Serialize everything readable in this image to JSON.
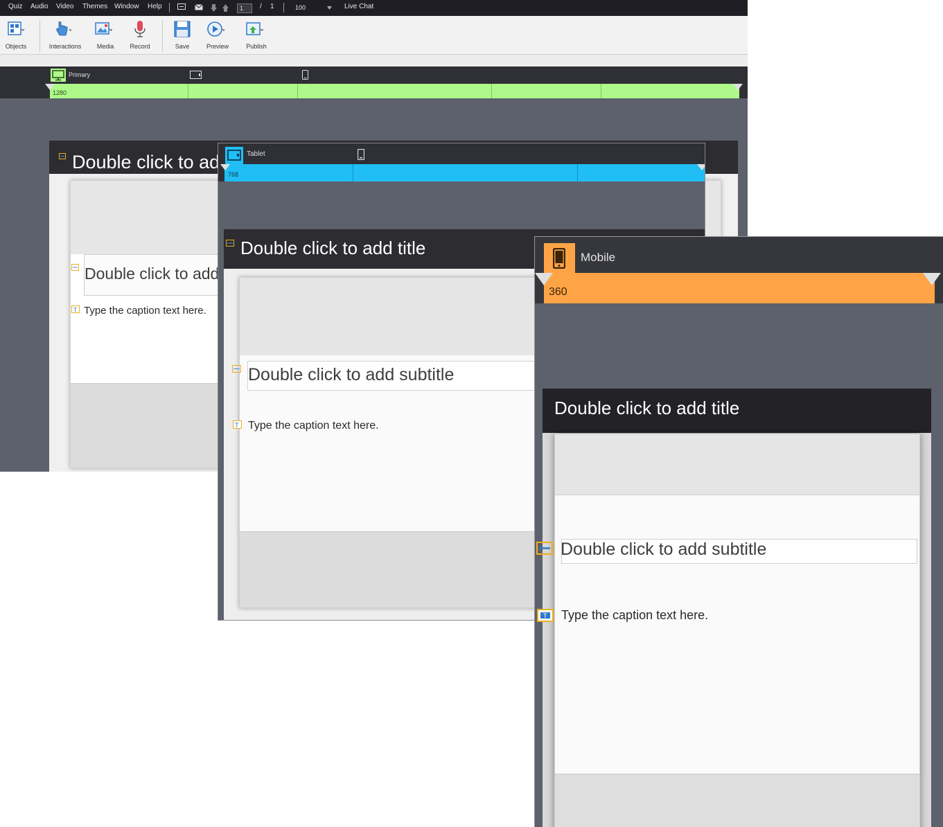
{
  "menubar": {
    "items": [
      "Quiz",
      "Audio",
      "Video",
      "Themes",
      "Window",
      "Help"
    ],
    "page_current": "1",
    "page_separator": "/",
    "page_total": "1",
    "zoom": "100",
    "live_chat": "Live Chat"
  },
  "toolbar": {
    "objects": "Objects",
    "interactions": "Interactions",
    "media": "Media",
    "record": "Record",
    "save": "Save",
    "preview": "Preview",
    "publish": "Publish"
  },
  "primary": {
    "breakpoint_label": "Primary",
    "breakpoint_width": "1280",
    "title": "Double click to add title",
    "subtitle": "Double click to add subtitle",
    "caption": "Type the caption text here."
  },
  "tablet": {
    "breakpoint_label": "Tablet",
    "breakpoint_width": "768",
    "title": "Double click to add title",
    "subtitle": "Double click to add subtitle",
    "caption": "Type the caption text here."
  },
  "mobile": {
    "breakpoint_label": "Mobile",
    "breakpoint_width": "360",
    "title": "Double click to add title",
    "subtitle": "Double click to add subtitle",
    "caption": "Type the caption text here."
  },
  "colors": {
    "primary_strip": "#aef98a",
    "tablet_strip": "#20bef5",
    "mobile_strip": "#fea447"
  }
}
